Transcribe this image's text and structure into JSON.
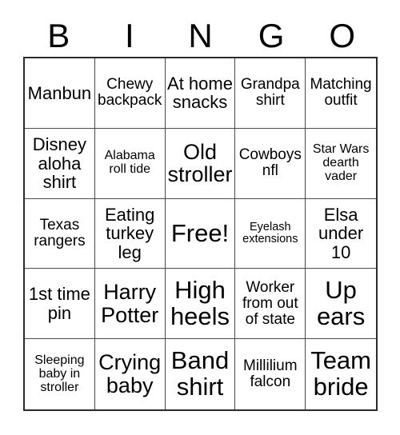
{
  "card": {
    "header_letters": [
      "B",
      "I",
      "N",
      "G",
      "O"
    ],
    "free_space_label": "Free!",
    "colors": {
      "background": "#ffffff",
      "text": "#000000",
      "grid_border": "#2b2b2b",
      "cell_divider": "#4a4a4a"
    },
    "rows": [
      [
        {
          "label": "Manbun",
          "size": "md"
        },
        {
          "label": "Chewy backpack",
          "size": "sm"
        },
        {
          "label": "At home snacks",
          "size": "md"
        },
        {
          "label": "Grandpa shirt",
          "size": "sm"
        },
        {
          "label": "Matching outfit",
          "size": "sm"
        }
      ],
      [
        {
          "label": "Disney aloha shirt",
          "size": "md"
        },
        {
          "label": "Alabama roll tide",
          "size": "xs"
        },
        {
          "label": "Old stroller",
          "size": "lg"
        },
        {
          "label": "Cowboys nfl",
          "size": "sm"
        },
        {
          "label": "Star Wars dearth vader",
          "size": "xs"
        }
      ],
      [
        {
          "label": "Texas rangers",
          "size": "sm"
        },
        {
          "label": "Eating turkey leg",
          "size": "md"
        },
        {
          "label": "Free!",
          "size": "xl"
        },
        {
          "label": "Eyelash extensions",
          "size": "xxs"
        },
        {
          "label": "Elsa under 10",
          "size": "md"
        }
      ],
      [
        {
          "label": "1st time pin",
          "size": "md"
        },
        {
          "label": "Harry Potter",
          "size": "lg"
        },
        {
          "label": "High heels",
          "size": "xl"
        },
        {
          "label": "Worker from out of state",
          "size": "sm"
        },
        {
          "label": "Up ears",
          "size": "xl"
        }
      ],
      [
        {
          "label": "Sleeping baby in stroller",
          "size": "xs"
        },
        {
          "label": "Crying baby",
          "size": "lg"
        },
        {
          "label": "Band shirt",
          "size": "xl"
        },
        {
          "label": "Millilium falcon",
          "size": "sm"
        },
        {
          "label": "Team bride",
          "size": "xl"
        }
      ]
    ]
  }
}
